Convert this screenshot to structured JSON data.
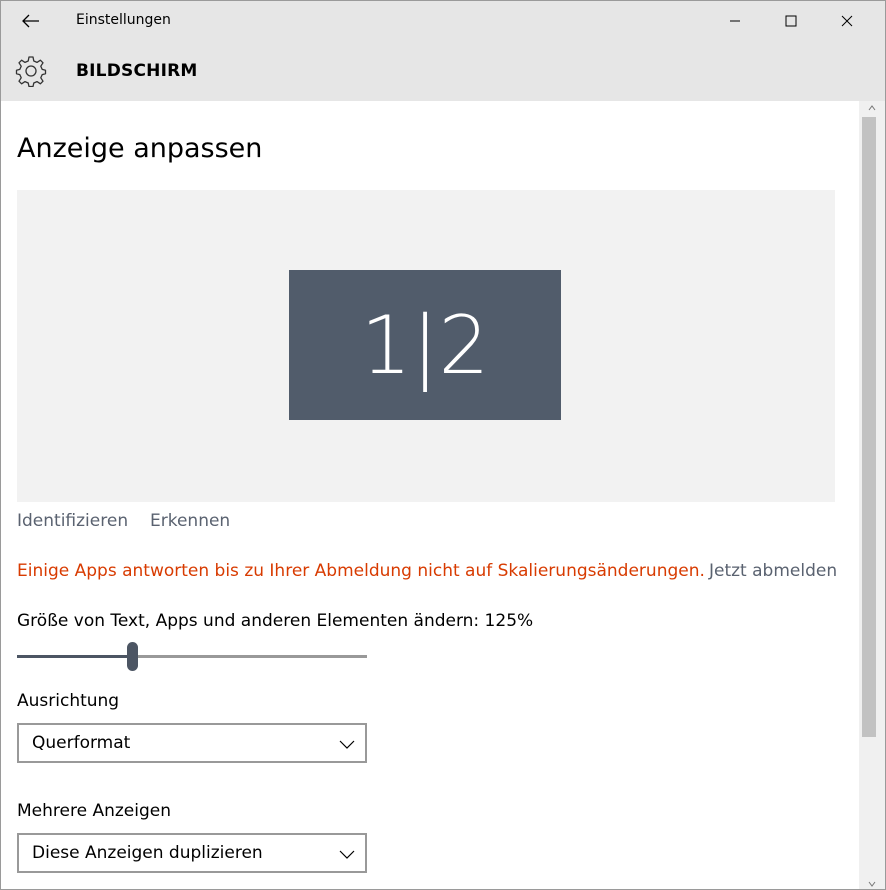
{
  "window": {
    "title": "Einstellungen"
  },
  "header": {
    "section": "BILDSCHIRM"
  },
  "main": {
    "page_title": "Anzeige anpassen",
    "monitor_label": "1|2",
    "identify_link": "Identifizieren",
    "detect_link": "Erkennen",
    "warning": "Einige Apps antworten bis zu Ihrer Abmeldung nicht auf Skalierungsänderungen.",
    "signout_link": "Jetzt abmelden",
    "scale_label": "Größe von Text, Apps und anderen Elementen ändern: 125%",
    "scale_fraction": 0.33,
    "orientation_label": "Ausrichtung",
    "orientation_value": "Querformat",
    "multi_display_label": "Mehrere Anzeigen",
    "multi_display_value": "Diese Anzeigen duplizieren"
  },
  "colors": {
    "accent_warning": "#d83b01",
    "link": "#5a6270",
    "monitor": "#515c6b",
    "titlebar": "#e6e6e6"
  },
  "icons": {
    "back": "arrow-left-icon",
    "minimize": "minimize-icon",
    "maximize": "maximize-icon",
    "close": "close-icon",
    "settings": "gear-icon",
    "dropdown": "chevron-down-icon"
  }
}
